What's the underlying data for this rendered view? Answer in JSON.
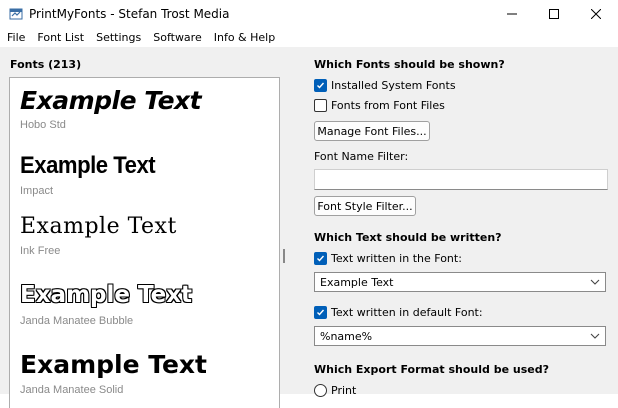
{
  "window": {
    "title": "PrintMyFonts - Stefan Trost Media",
    "controls": [
      "minimize",
      "maximize",
      "close"
    ]
  },
  "menu": [
    "File",
    "Font List",
    "Settings",
    "Software",
    "Info & Help"
  ],
  "fonts_panel": {
    "label": "Fonts (213)",
    "entries": [
      {
        "sample": "Example Text",
        "name": "Hobo Std"
      },
      {
        "sample": "Example Text",
        "name": "Impact"
      },
      {
        "sample": "Example Text",
        "name": "Ink Free"
      },
      {
        "sample": "Example Text",
        "name": "Janda Manatee Bubble"
      },
      {
        "sample": "Example Text",
        "name": "Janda Manatee Solid"
      }
    ]
  },
  "settings": {
    "which_fonts": {
      "heading": "Which Fonts should be shown?",
      "installed_label": "Installed System Fonts",
      "installed_checked": true,
      "from_files_label": "Fonts from Font Files",
      "from_files_checked": false,
      "manage_button": "Manage Font Files...",
      "filter_label": "Font Name Filter:",
      "filter_value": "",
      "style_filter_button": "Font Style Filter..."
    },
    "which_text": {
      "heading": "Which Text should be written?",
      "in_font_label": "Text written in the Font:",
      "in_font_checked": true,
      "in_font_value": "Example Text",
      "default_font_label": "Text written in default Font:",
      "default_font_checked": true,
      "default_font_value": "%name%"
    },
    "export": {
      "heading": "Which Export Format should be used?",
      "print_label": "Print"
    }
  },
  "colors": {
    "accent": "#005fb8",
    "panel_bg": "#f0f0f0",
    "font_name_gray": "#8a8a8a"
  }
}
